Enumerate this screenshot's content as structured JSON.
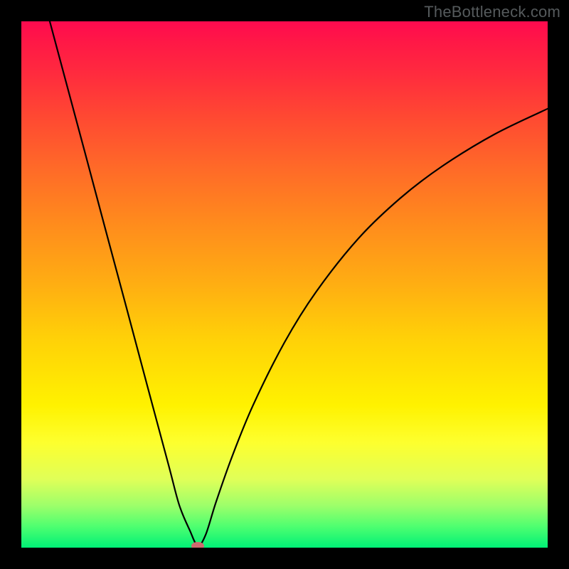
{
  "watermark": {
    "text": "TheBottleneck.com"
  },
  "chart_data": {
    "type": "line",
    "title": "",
    "xlabel": "",
    "ylabel": "",
    "xlim": [
      0,
      100
    ],
    "ylim": [
      0,
      100
    ],
    "grid": false,
    "legend": false,
    "background_gradient": {
      "direction": "vertical",
      "stops": [
        {
          "pos": 0.0,
          "color": "#ff0a4f"
        },
        {
          "pos": 0.5,
          "color": "#ffae12"
        },
        {
          "pos": 0.73,
          "color": "#fff200"
        },
        {
          "pos": 1.0,
          "color": "#00f076"
        }
      ]
    },
    "series": [
      {
        "name": "bottleneck-curve",
        "x": [
          5.4,
          8,
          12,
          16,
          20,
          24,
          28,
          30,
          32,
          33.5,
          35,
          37,
          40,
          44,
          50,
          56,
          64,
          72,
          80,
          90,
          100
        ],
        "y": [
          100,
          90.3,
          75.4,
          60.4,
          45.5,
          30.5,
          15.6,
          8.1,
          3.3,
          0.4,
          2.4,
          8.7,
          17.2,
          27.0,
          39.0,
          48.6,
          58.7,
          66.4,
          72.5,
          78.6,
          83.4
        ]
      }
    ],
    "marker": {
      "x": 33.5,
      "y": 0.4,
      "color": "#cf6a6f"
    }
  }
}
